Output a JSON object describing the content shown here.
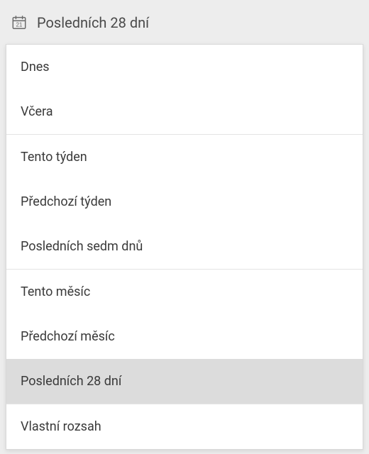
{
  "header": {
    "title": "Posledních 28 dní",
    "icon_day_number": "21"
  },
  "groups": [
    {
      "items": [
        {
          "label": "Dnes",
          "selected": false
        },
        {
          "label": "Včera",
          "selected": false
        }
      ]
    },
    {
      "items": [
        {
          "label": "Tento týden",
          "selected": false
        },
        {
          "label": "Předchozí týden",
          "selected": false
        },
        {
          "label": "Posledních sedm dnů",
          "selected": false
        }
      ]
    },
    {
      "items": [
        {
          "label": "Tento měsíc",
          "selected": false
        },
        {
          "label": "Předchozí měsíc",
          "selected": false
        },
        {
          "label": "Posledních 28 dní",
          "selected": true
        }
      ]
    },
    {
      "items": [
        {
          "label": "Vlastní rozsah",
          "selected": false
        }
      ]
    }
  ]
}
